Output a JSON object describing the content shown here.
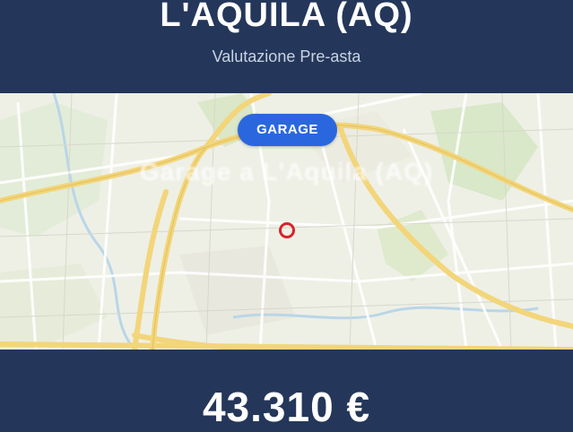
{
  "header": {
    "city": "L'AQUILA (AQ)",
    "subtitle": "Valutazione Pre-asta"
  },
  "map": {
    "badge": "GARAGE",
    "overlay_title": "Garage a L'Aquila (AQ)",
    "marker_color": "#d8232a"
  },
  "footer": {
    "price": "43.310 €"
  },
  "colors": {
    "navy": "#24375a",
    "badge_blue": "#2a67df"
  }
}
